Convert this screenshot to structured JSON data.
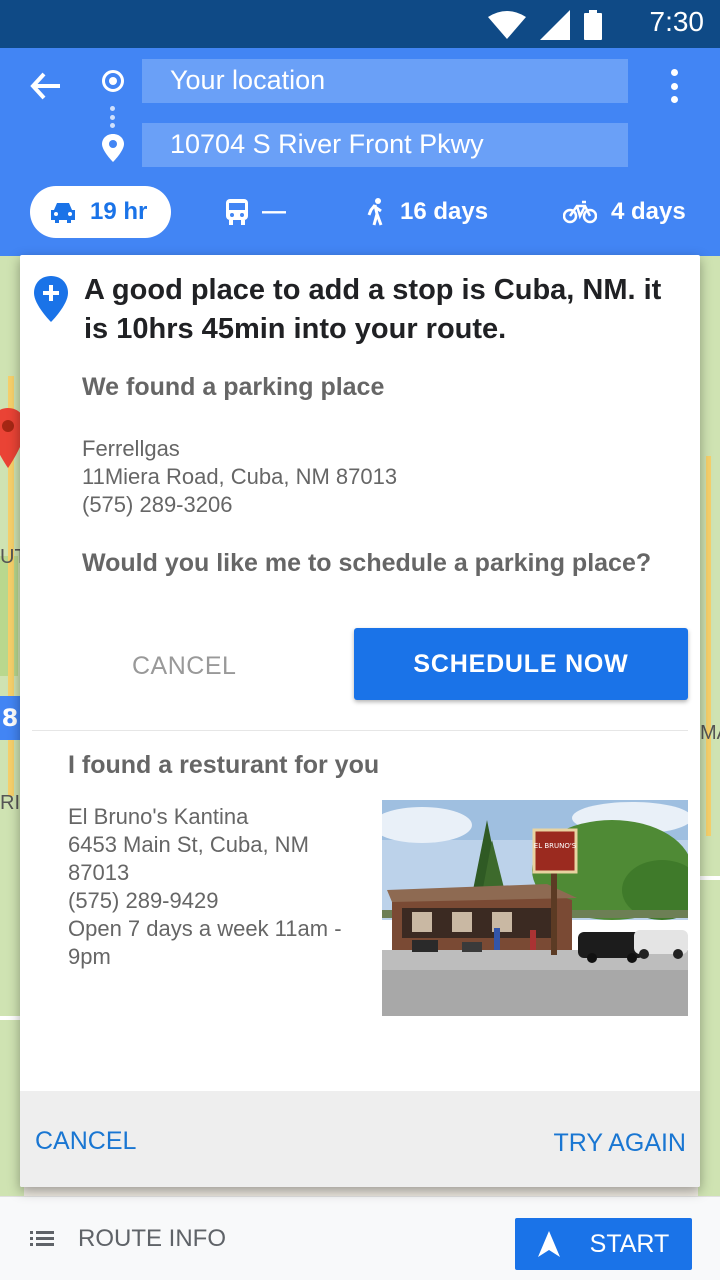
{
  "status_bar": {
    "time": "7:30"
  },
  "directions": {
    "origin": "Your location",
    "destination": "10704 S River Front Pkwy",
    "modes": [
      {
        "label": "19 hr",
        "icon": "car-icon",
        "active": true
      },
      {
        "label": "—",
        "icon": "transit-icon",
        "active": false
      },
      {
        "label": "16 days",
        "icon": "walk-icon",
        "active": false
      },
      {
        "label": "4 days",
        "icon": "bike-icon",
        "active": false
      }
    ]
  },
  "map": {
    "labels": [
      "UT",
      "RIZ",
      "MA"
    ],
    "highway_badge": "8"
  },
  "dialog": {
    "title": "A good place to add a stop is Cuba, NM. it is 10hrs 45min into your route.",
    "parking": {
      "heading": "We found a parking place",
      "address": "Ferrellgas\n11Miera Road, Cuba, NM 87013\n(575) 289-3206",
      "question": "Would you like me to schedule a parking place?",
      "cancel_label": "CANCEL",
      "schedule_label": "SCHEDULE NOW"
    },
    "restaurant": {
      "heading": "I found a resturant for you",
      "address": "El Bruno's Kantina\n6453 Main St, Cuba, NM\n87013\n(575) 289-9429\nOpen 7 days a week 11am -\n9pm",
      "sign_text": "EL BRUNO'S"
    },
    "footer": {
      "cancel_label": "CANCEL",
      "retry_label": "TRY AGAIN"
    }
  },
  "bottom_bar": {
    "route_info_label": "ROUTE INFO",
    "start_label": "START"
  },
  "colors": {
    "status_bar": "#0f4a86",
    "header": "#4285f4",
    "accent": "#1a73e8"
  }
}
